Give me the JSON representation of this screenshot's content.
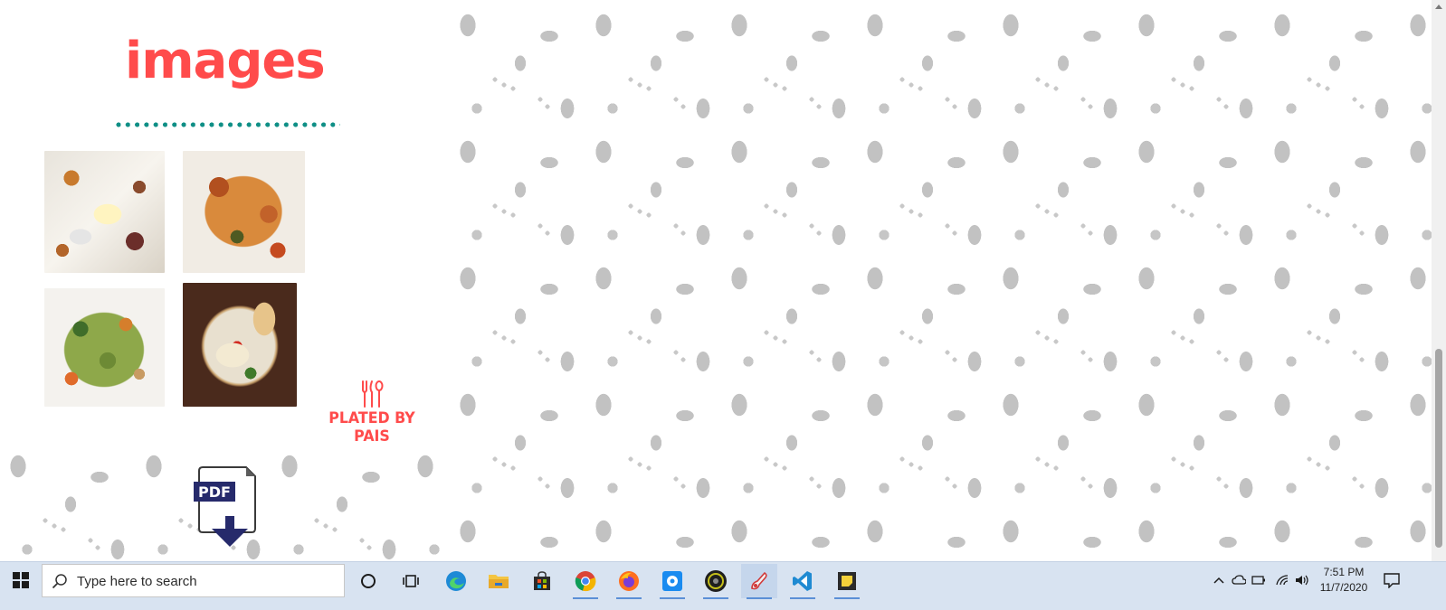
{
  "page": {
    "heading": "images",
    "images": [
      {
        "alt": "chicken with roasted vegetables"
      },
      {
        "alt": "vegetable stew"
      },
      {
        "alt": "salad with tofu"
      },
      {
        "alt": "tacos on plate"
      }
    ],
    "brand": {
      "name": "PLATED BY PAIS",
      "icon": "fork-knife-spoon-icon"
    },
    "pdf": {
      "label": "PDF",
      "icon": "pdf-download-icon"
    },
    "colors": {
      "accent": "#ff4b4b",
      "divider": "#0f8f86",
      "pattern": "#c2c2c2"
    }
  },
  "taskbar": {
    "search_placeholder": "Type here to search",
    "apps": [
      {
        "name": "cortana",
        "icon": "circle-icon"
      },
      {
        "name": "task-view",
        "icon": "task-view-icon"
      },
      {
        "name": "edge",
        "icon": "edge-icon"
      },
      {
        "name": "file-explorer",
        "icon": "folder-icon"
      },
      {
        "name": "store",
        "icon": "store-icon"
      },
      {
        "name": "chrome",
        "icon": "chrome-icon"
      },
      {
        "name": "firefox",
        "icon": "firefox-icon"
      },
      {
        "name": "app",
        "icon": "app-icon"
      },
      {
        "name": "obs",
        "icon": "obs-icon"
      },
      {
        "name": "paint",
        "icon": "paint-icon"
      },
      {
        "name": "vscode",
        "icon": "vscode-icon"
      },
      {
        "name": "sticky-notes",
        "icon": "sticky-notes-icon"
      }
    ],
    "clock": {
      "time": "7:51 PM",
      "date": "11/7/2020"
    }
  }
}
